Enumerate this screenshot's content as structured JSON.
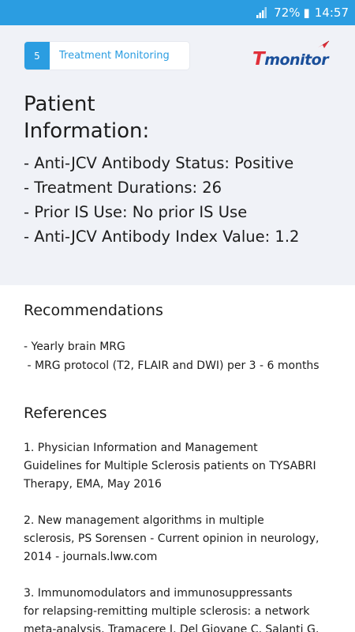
{
  "status_bar": {
    "battery": "72%",
    "time": "14:57"
  },
  "step": {
    "number": "5",
    "label": "Treatment Monitoring"
  },
  "logo": {
    "t_letter": "T",
    "rest": "monitor"
  },
  "patient": {
    "title_line1": "Patient",
    "title_line2": "Information:",
    "lines": [
      "- Anti-JCV Antibody Status: Positive",
      "- Treatment Durations: 26",
      "- Prior IS Use: No prior IS Use",
      "- Anti-JCV Antibody Index Value: 1.2"
    ]
  },
  "recommendations": {
    "heading": "Recommendations",
    "items": [
      "- Yearly brain MRG",
      " - MRG protocol (T2, FLAIR and DWI) per 3 - 6 months"
    ]
  },
  "references": {
    "heading": "References",
    "items": [
      "1. Physician Information and Management\nGuidelines for Multiple Sclerosis patients on TYSABRI\nTherapy, EMA, May 2016",
      " 2. New management algorithms in multiple\nsclerosis, PS Sorensen - Current opinion in neurology,\n2014 - journals.lww.com",
      " 3. Immunomodulators and immunosuppressants\nfor relapsing-remitting multiple sclerosis: a network\nmeta-analysis, Tramacere I, Del Giovane C, Salanti G,"
    ]
  },
  "colors": {
    "accent": "#2b9de1",
    "top_background": "#f0f2f7",
    "logo_blue": "#1a4f9a",
    "logo_red": "#e0303a"
  },
  "icons": {
    "wifi": "wifi-signal-icon",
    "plane": "plane-icon"
  }
}
